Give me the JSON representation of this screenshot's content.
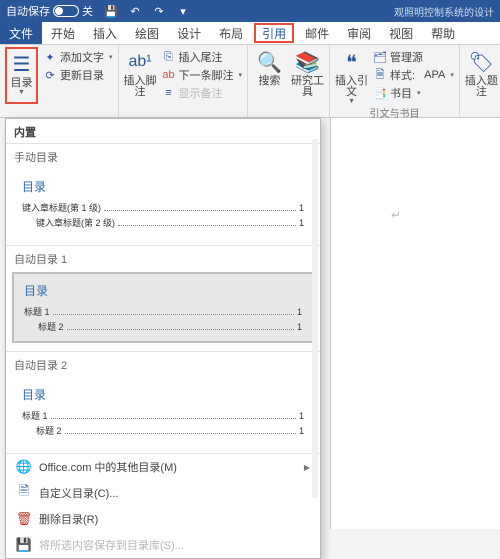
{
  "titlebar": {
    "autosave_label": "自动保存",
    "autosave_state": "关",
    "doc_title": "观照明控制系统的设计"
  },
  "tabs": {
    "file": "文件",
    "home": "开始",
    "insert": "插入",
    "draw": "绘图",
    "design": "设计",
    "layout": "布局",
    "references": "引用",
    "mailings": "邮件",
    "review": "审阅",
    "view": "视图",
    "help": "帮助"
  },
  "ribbon": {
    "toc": {
      "toc_label": "目录",
      "add_text": "添加文字",
      "update": "更新目录"
    },
    "footnotes": {
      "insert_footnote": "插入脚注",
      "insert_endnote": "插入尾注",
      "next_footnote": "下一条脚注",
      "show_notes": "显示备注"
    },
    "research": {
      "search": "搜索",
      "tools": "研究工具"
    },
    "citations": {
      "insert_citation": "插入引文",
      "manage_sources": "管理源",
      "style_label": "样式:",
      "style_value": "APA",
      "bibliography": "书目",
      "group_label": "引文与书目"
    },
    "captions": {
      "insert_caption": "插入题注"
    }
  },
  "toc_menu": {
    "header": "内置",
    "manual": {
      "title": "手动目录",
      "heading": "目录",
      "line1_text": "键入章标题(第 1 级)",
      "line1_page": "1",
      "line2_text": "键入章标题(第 2 级)",
      "line2_page": "1"
    },
    "auto1": {
      "title": "自动目录 1",
      "heading": "目录",
      "line1_text": "标题 1",
      "line1_page": "1",
      "line2_text": "标题 2",
      "line2_page": "1"
    },
    "auto2": {
      "title": "自动目录 2",
      "heading": "目录",
      "line1_text": "标题 1",
      "line1_page": "1",
      "line2_text": "标题 2",
      "line2_page": "1"
    },
    "more_office": "Office.com 中的其他目录(M)",
    "custom": "自定义目录(C)...",
    "remove": "删除目录(R)",
    "save_selection": "将所选内容保存到目录库(S)..."
  }
}
